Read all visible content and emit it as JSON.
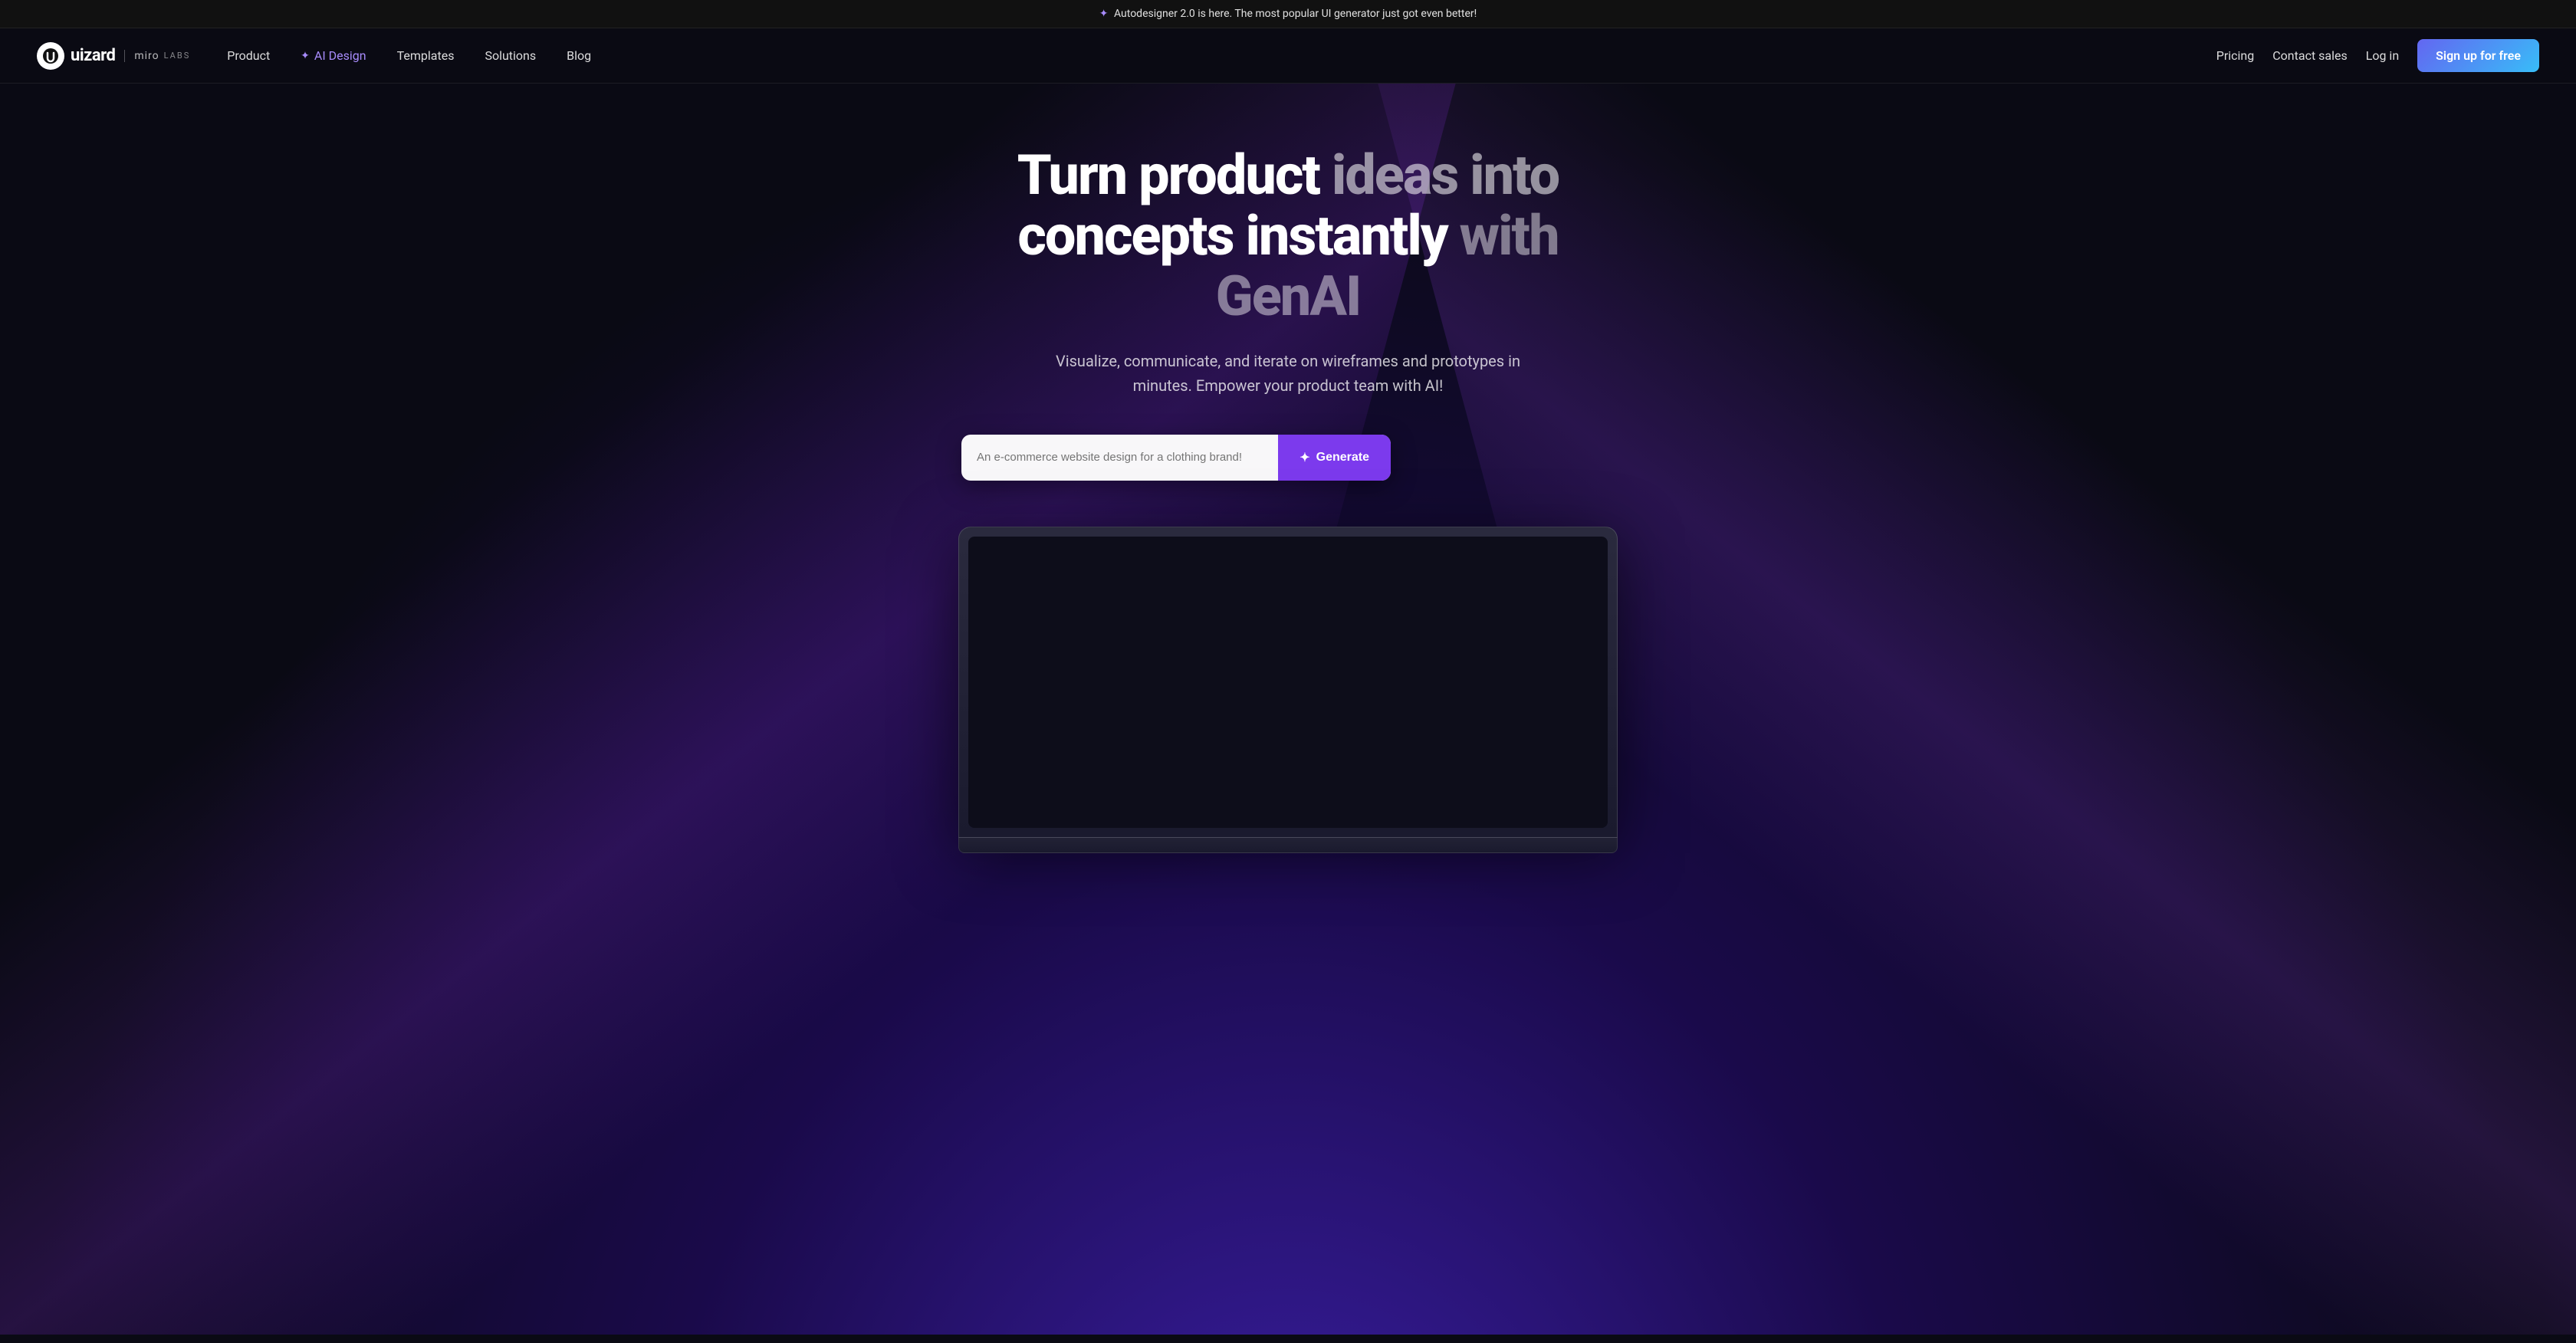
{
  "announcement": {
    "icon": "✦",
    "text": "Autodesigner 2.0 is here. The most popular UI generator just got even better!"
  },
  "navbar": {
    "logo": {
      "icon": "⊙",
      "brand": "uizard",
      "partner_brand": "miro",
      "partner_sub": "LABS"
    },
    "nav_links": [
      {
        "label": "Product",
        "href": "#",
        "active": false,
        "ai": false
      },
      {
        "label": "✦ AI Design",
        "href": "#",
        "active": true,
        "ai": true
      },
      {
        "label": "Templates",
        "href": "#",
        "active": false,
        "ai": false
      },
      {
        "label": "Solutions",
        "href": "#",
        "active": false,
        "ai": false
      },
      {
        "label": "Blog",
        "href": "#",
        "active": false,
        "ai": false
      }
    ],
    "right_links": [
      {
        "label": "Pricing",
        "href": "#"
      },
      {
        "label": "Contact sales",
        "href": "#"
      },
      {
        "label": "Log in",
        "href": "#"
      }
    ],
    "cta": "Sign up for free"
  },
  "hero": {
    "title_line1_white": "Turn product",
    "title_line1_gray": "ideas into",
    "title_line2_white": "concepts instantly",
    "title_line2_gray": "with GenAI",
    "subtitle": "Visualize, communicate, and iterate on wireframes and prototypes in minutes. Empower your product team with AI!",
    "input_placeholder": "An e-commerce website design for a clothing brand!",
    "generate_btn": "Generate",
    "sparkle": "✦"
  }
}
